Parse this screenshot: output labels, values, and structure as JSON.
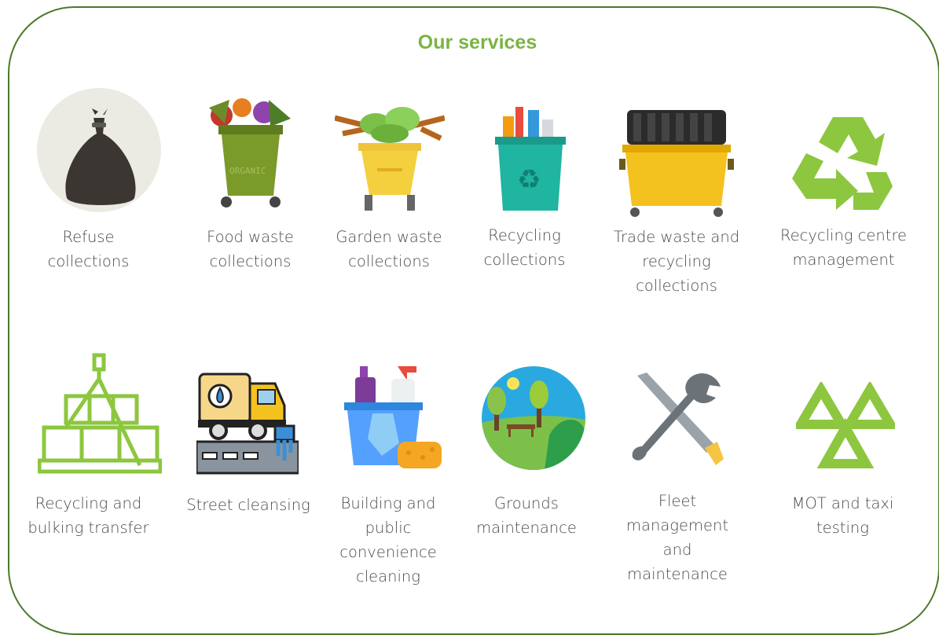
{
  "title": "Our services",
  "accent_color": "#7cb342",
  "border_color": "#4b7a2a",
  "services": [
    {
      "name": "refuse-collections",
      "icon": "bin-bag-icon",
      "lines": [
        "Refuse",
        "collections"
      ]
    },
    {
      "name": "food-waste-collections",
      "icon": "organic-bin-icon",
      "lines": [
        "Food waste",
        "collections"
      ]
    },
    {
      "name": "garden-waste-collections",
      "icon": "garden-bin-icon",
      "lines": [
        "Garden waste",
        "collections"
      ]
    },
    {
      "name": "recycling-collections",
      "icon": "recycling-bin-icon",
      "lines": [
        "Recycling",
        "collections"
      ]
    },
    {
      "name": "trade-waste",
      "icon": "dumpster-icon",
      "lines": [
        "Trade waste and",
        "recycling",
        "collections"
      ]
    },
    {
      "name": "recycling-centre",
      "icon": "recycle-symbol-icon",
      "lines": [
        "Recycling centre",
        "management"
      ]
    },
    {
      "name": "recycling-bulking",
      "icon": "crane-boxes-icon",
      "lines": [
        "Recycling and",
        "bulking transfer"
      ]
    },
    {
      "name": "street-cleansing",
      "icon": "street-sweeper-icon",
      "lines": [
        "Street cleansing"
      ]
    },
    {
      "name": "building-cleaning",
      "icon": "cleaning-supplies-icon",
      "lines": [
        "Building and",
        "public",
        "convenience",
        "cleaning"
      ]
    },
    {
      "name": "grounds-maintenance",
      "icon": "park-icon",
      "lines": [
        "Grounds",
        "maintenance"
      ]
    },
    {
      "name": "fleet-management",
      "icon": "tools-icon",
      "lines": [
        "Fleet",
        "management",
        "and",
        "maintenance"
      ]
    },
    {
      "name": "mot-taxi-testing",
      "icon": "mot-triangles-icon",
      "lines": [
        "MOT and taxi",
        "testing"
      ]
    }
  ]
}
